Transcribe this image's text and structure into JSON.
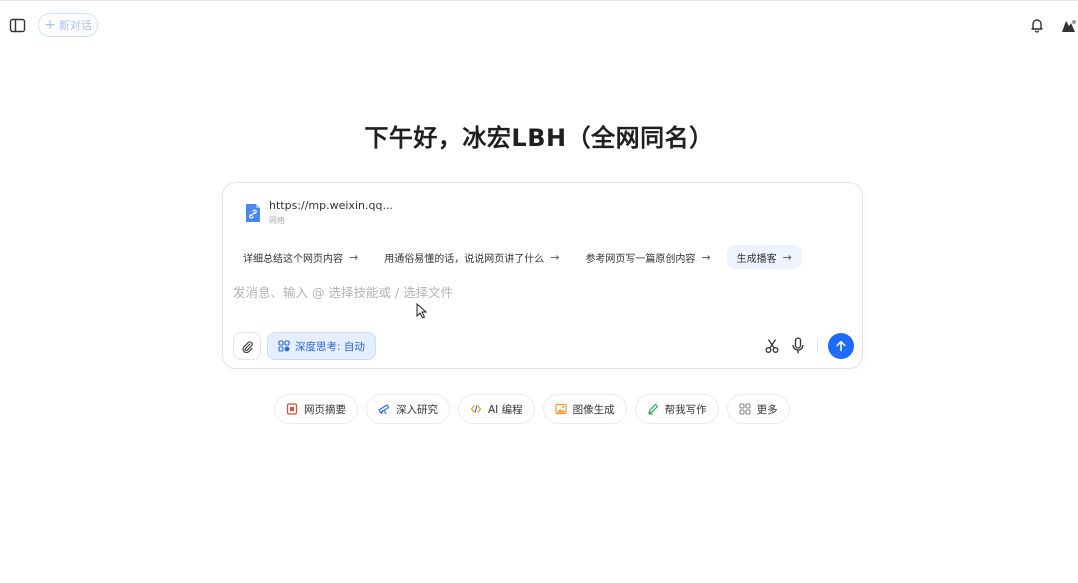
{
  "header": {
    "new_chat_label": "新对话",
    "sidebar_icon": "sidebar-toggle-icon",
    "bell_icon": "bell-icon"
  },
  "greeting": "下午好，冰宏LBH（全网同名）",
  "composer": {
    "attachment": {
      "title": "https://mp.weixin.qq...",
      "subtitle": "网络",
      "icon": "link-file-icon"
    },
    "suggestions": [
      {
        "label": "详细总结这个网页内容",
        "arrow": "→"
      },
      {
        "label": "用通俗易懂的话，说说网页讲了什么",
        "arrow": "→"
      },
      {
        "label": "参考网页写一篇原创内容",
        "arrow": "→"
      },
      {
        "label": "生成播客",
        "arrow": "→"
      }
    ],
    "placeholder": "发消息、输入 @ 选择技能或 / 选择文件",
    "deep_think_label": "深度思考: 自动"
  },
  "quick_actions": [
    {
      "label": "网页摘要",
      "icon": "webpage-summary-icon",
      "color": "#e4473b"
    },
    {
      "label": "深入研究",
      "icon": "telescope-icon",
      "color": "#3d6ee8"
    },
    {
      "label": "AI 编程",
      "icon": "code-icon",
      "color": "#f0a020"
    },
    {
      "label": "图像生成",
      "icon": "image-icon",
      "color": "#f09a2a"
    },
    {
      "label": "帮我写作",
      "icon": "pen-icon",
      "color": "#2fa84f"
    },
    {
      "label": "更多",
      "icon": "grid-icon",
      "color": "#888888"
    }
  ],
  "colors": {
    "accent": "#1f6bff",
    "deep_think_bg": "#e5efff",
    "active_suggestion_bg": "#eef4fd"
  }
}
